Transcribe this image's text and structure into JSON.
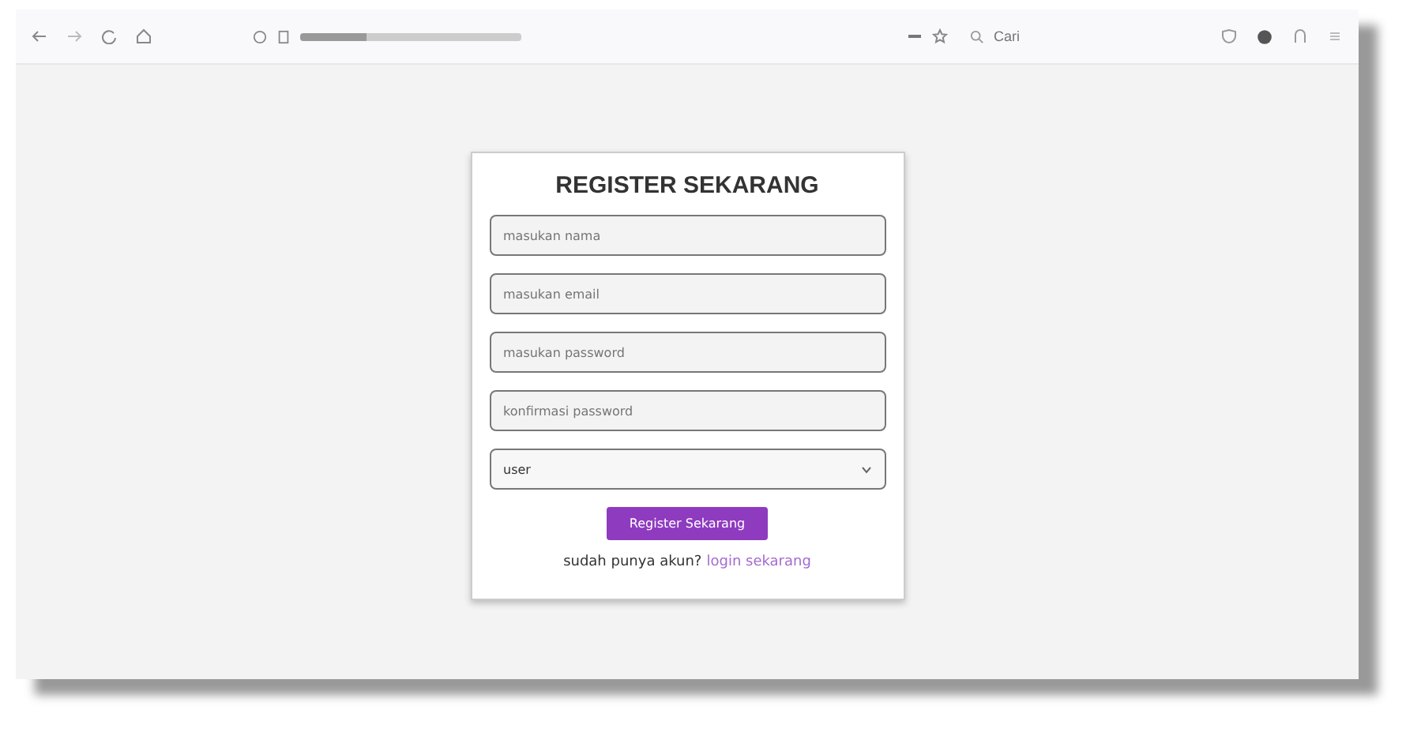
{
  "browser": {
    "search_placeholder": "Cari"
  },
  "form": {
    "title": "REGISTER SEKARANG",
    "fields": [
      {
        "kind": "text",
        "placeholder": "masukan nama"
      },
      {
        "kind": "text",
        "placeholder": "masukan email"
      },
      {
        "kind": "text",
        "placeholder": "masukan password"
      },
      {
        "kind": "text",
        "placeholder": "konfirmasi password"
      },
      {
        "kind": "select",
        "value": "user"
      }
    ],
    "submit": "Register Sekarang",
    "footer_text": "sudah punya akun?",
    "footer_link": "login sekarang"
  }
}
